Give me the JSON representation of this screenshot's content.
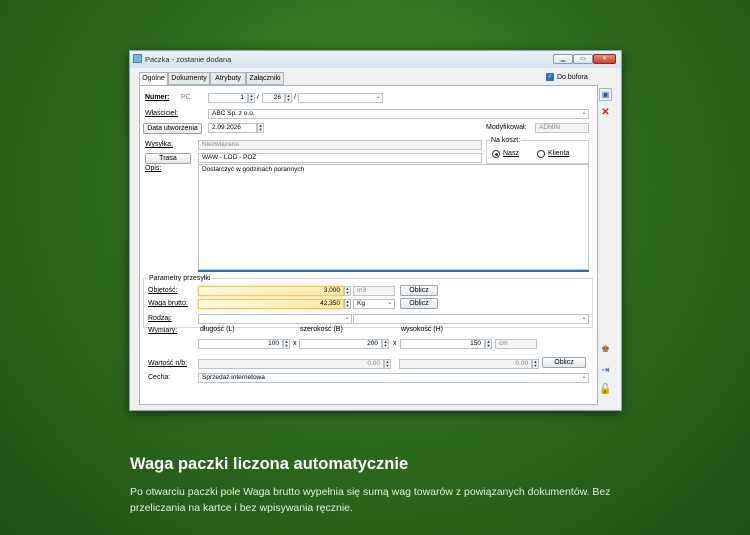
{
  "window": {
    "title": "Paczka - zostanie dodana",
    "tabs": [
      "Ogólne",
      "Dokumenty",
      "Atrybuty",
      "Załączniki"
    ],
    "do_bufora_label": "Do bufora"
  },
  "form": {
    "numer_label": "Numer:",
    "numer_prefix": "PC",
    "numer_value": "1",
    "numer_month": "26",
    "numer_slash": "/",
    "wlasciciel_label": "Właściciel:",
    "wlasciciel_value": "ABC Sp. z o.o.",
    "data_label": "Data utworzenia",
    "data_value": "2.09.2026",
    "modyfikowal_label": "Modyfikował:",
    "modyfikowal_value": "ADMIN",
    "wysylka_label": "Wysyłka:",
    "wysylka_value": "Niezwiązana",
    "trasa_label": "Trasa",
    "trasa_value": "WAW - LOD - POZ",
    "na_koszt_label": "Na koszt:",
    "nasz_label": "Nasz",
    "klienta_label": "Klienta",
    "opis_label": "Opis:",
    "opis_value": "Dostarczyć w godzinach porannych",
    "params_title": "Parametry przesyłki",
    "objetosc_label": "Objętość:",
    "objetosc_value": "3,000",
    "objetosc_unit": "m3",
    "waga_label": "Waga brutto:",
    "waga_value": "42,350",
    "waga_unit": "Kg",
    "oblicz_label": "Oblicz",
    "rodzaj_label": "Rodzaj:",
    "wymiary_label": "Wymiary:",
    "dlugosc_label": "długość (L)",
    "szerokosc_label": "szerokość (B)",
    "wysokosc_label": "wysokość (H)",
    "dlugosc_value": "100",
    "szerokosc_value": "200",
    "wysokosc_value": "150",
    "times": "x",
    "wymiary_unit": "cm",
    "wartosc_label": "Wartość n/b:",
    "wartosc_value1": "0,00",
    "wartosc_value2": "0,00",
    "cecha_label": "Cecha:",
    "cecha_value": "Sprzedaż internetowa"
  },
  "caption": {
    "title": "Waga paczki liczona automatycznie",
    "text": "Po otwarciu paczki pole Waga brutto wypełnia się sumą wag towarów z powiązanych dokumentów. Bez przeliczania na kartce i bez wpisywania ręcznie."
  },
  "icons": {
    "save": "save-icon",
    "delete": "delete-icon",
    "users": "users-icon",
    "pin": "pin-icon",
    "lock": "lock-icon"
  }
}
